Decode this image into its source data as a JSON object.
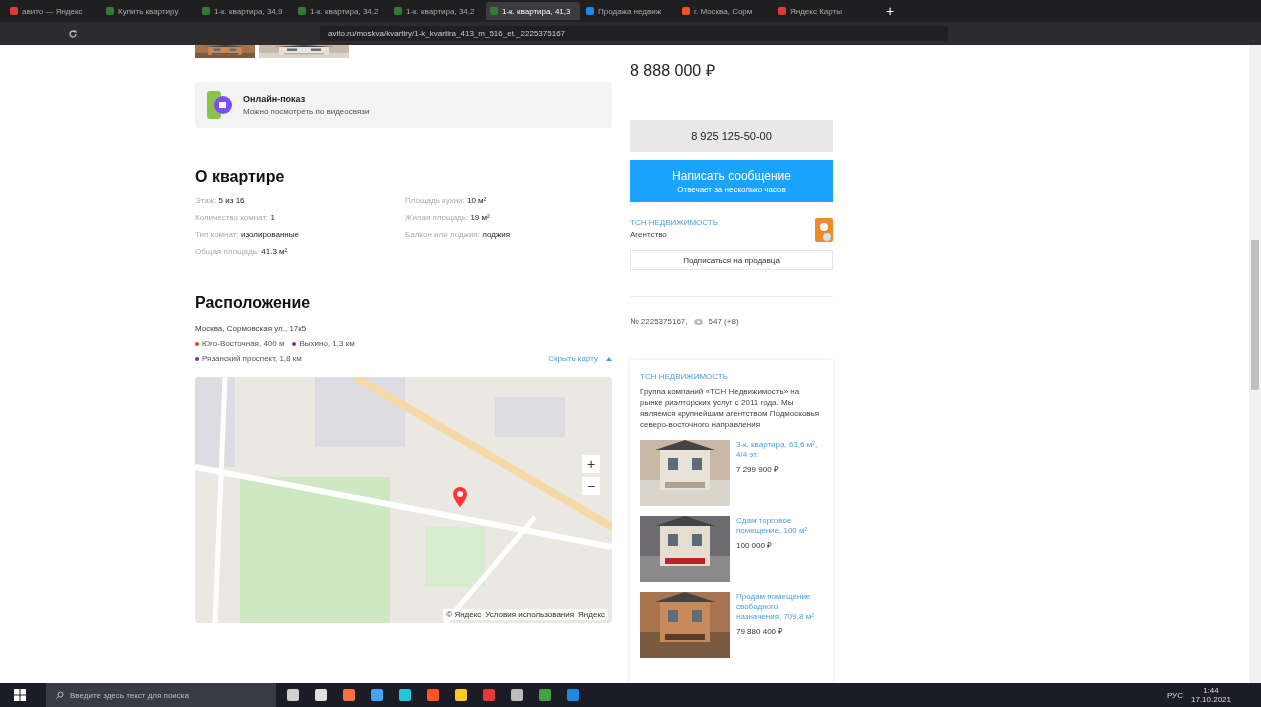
{
  "browser": {
    "tabs": [
      {
        "title": "авито — Яндекс",
        "selected": false,
        "color": "#e53935"
      },
      {
        "title": "Купить квартиру",
        "selected": false,
        "color": "#2e7d32"
      },
      {
        "title": "1-к. квартира, 34,9",
        "selected": false,
        "color": "#2e7d32"
      },
      {
        "title": "1-к. квартира, 34,2",
        "selected": false,
        "color": "#2e7d32"
      },
      {
        "title": "1-к. квартира, 34,2",
        "selected": false,
        "color": "#2e7d32"
      },
      {
        "title": "1-к. квартира, 41,3",
        "selected": true,
        "color": "#2e7d32"
      },
      {
        "title": "Продажа недвиж",
        "selected": false,
        "color": "#1e88e5"
      },
      {
        "title": "г. Москва, Сорм",
        "selected": false,
        "color": "#f4511e"
      },
      {
        "title": "Яндекс Карты",
        "selected": false,
        "color": "#e53935"
      }
    ],
    "new_tab": "+",
    "url": "avito.ru/moskva/kvartiry/1-k_kvartira_413_m_516_et._2225375167"
  },
  "online_show": {
    "title": "Онлайн-показ",
    "subtitle": "Можно посмотреть по видеосвязи"
  },
  "about": {
    "title": "О квартире",
    "params": [
      {
        "label": "Этаж:",
        "value": "5 из 16"
      },
      {
        "label": "Площадь кухни:",
        "value": "10 м²"
      },
      {
        "label": "Количество комнат:",
        "value": "1"
      },
      {
        "label": "Жилая площадь:",
        "value": "19 м²"
      },
      {
        "label": "Тип комнат:",
        "value": "изолированные"
      },
      {
        "label": "Балкон или лоджия:",
        "value": "лоджия"
      },
      {
        "label": "Общая площадь:",
        "value": "41.3 м²"
      }
    ]
  },
  "location": {
    "title": "Расположение",
    "address": "Москва, Сормовская ул., 17к5",
    "metro": [
      {
        "name": "Юго-Восточная, 400 м",
        "color": "#e53935"
      },
      {
        "name": "Выхино, 1,3 км",
        "color": "#8e24aa"
      },
      {
        "name": "Рязанский проспект, 1,8 км",
        "color": "#8e24aa"
      }
    ],
    "hide_map": "Скрыть карту",
    "map": {
      "zoom_in": "+",
      "zoom_out": "−",
      "attribution": [
        "© Яндекс",
        "Условия использования",
        "Яндекс"
      ]
    }
  },
  "price": "8 888 000 ₽",
  "phone": "8 925 125-50-00",
  "message": {
    "title": "Написать сообщение",
    "subtitle": "Отвечает за несколько часов"
  },
  "seller": {
    "name": "ТСН НЕДВИЖИМОСТЬ",
    "type": "Агентство",
    "subscribe": "Подписаться на продавца"
  },
  "ad_info": {
    "number": "№ 2225375167,",
    "views": "547 (+8)"
  },
  "agency_card": {
    "name": "ТСН НЕДВИЖИМОСТЬ",
    "description": "Группа компаний «ТСН Недвижимость» на рынке риэлторских услуг с 2011 года. Мы являемся крупнейшим агентством Подмосковья северо-восточного направления",
    "listings": [
      {
        "title": "3-к. квартира, 63,6 м², 4/4 эт.",
        "price": "7 299 900 ₽"
      },
      {
        "title": "Сдам торговое помещение, 100 м²",
        "price": "100 000 ₽"
      },
      {
        "title": "Продам помещение свободного назначения, 709,8 м²",
        "price": "79 880 400 ₽"
      }
    ]
  },
  "taskbar": {
    "search_placeholder": "Введите здесь текст для поиска",
    "apps": [
      {
        "color": "#cfcfcf"
      },
      {
        "color": "#e0e0e0"
      },
      {
        "color": "#ff7043"
      },
      {
        "color": "#42a5f5"
      },
      {
        "color": "#26c6da"
      },
      {
        "color": "#ff5722"
      },
      {
        "color": "#ffca28"
      },
      {
        "color": "#e53935"
      },
      {
        "color": "#bdbdbd"
      },
      {
        "color": "#43a047"
      },
      {
        "color": "#1e88e5"
      }
    ],
    "language": "РУС",
    "time": "1:44",
    "date": "17.10.2021"
  }
}
